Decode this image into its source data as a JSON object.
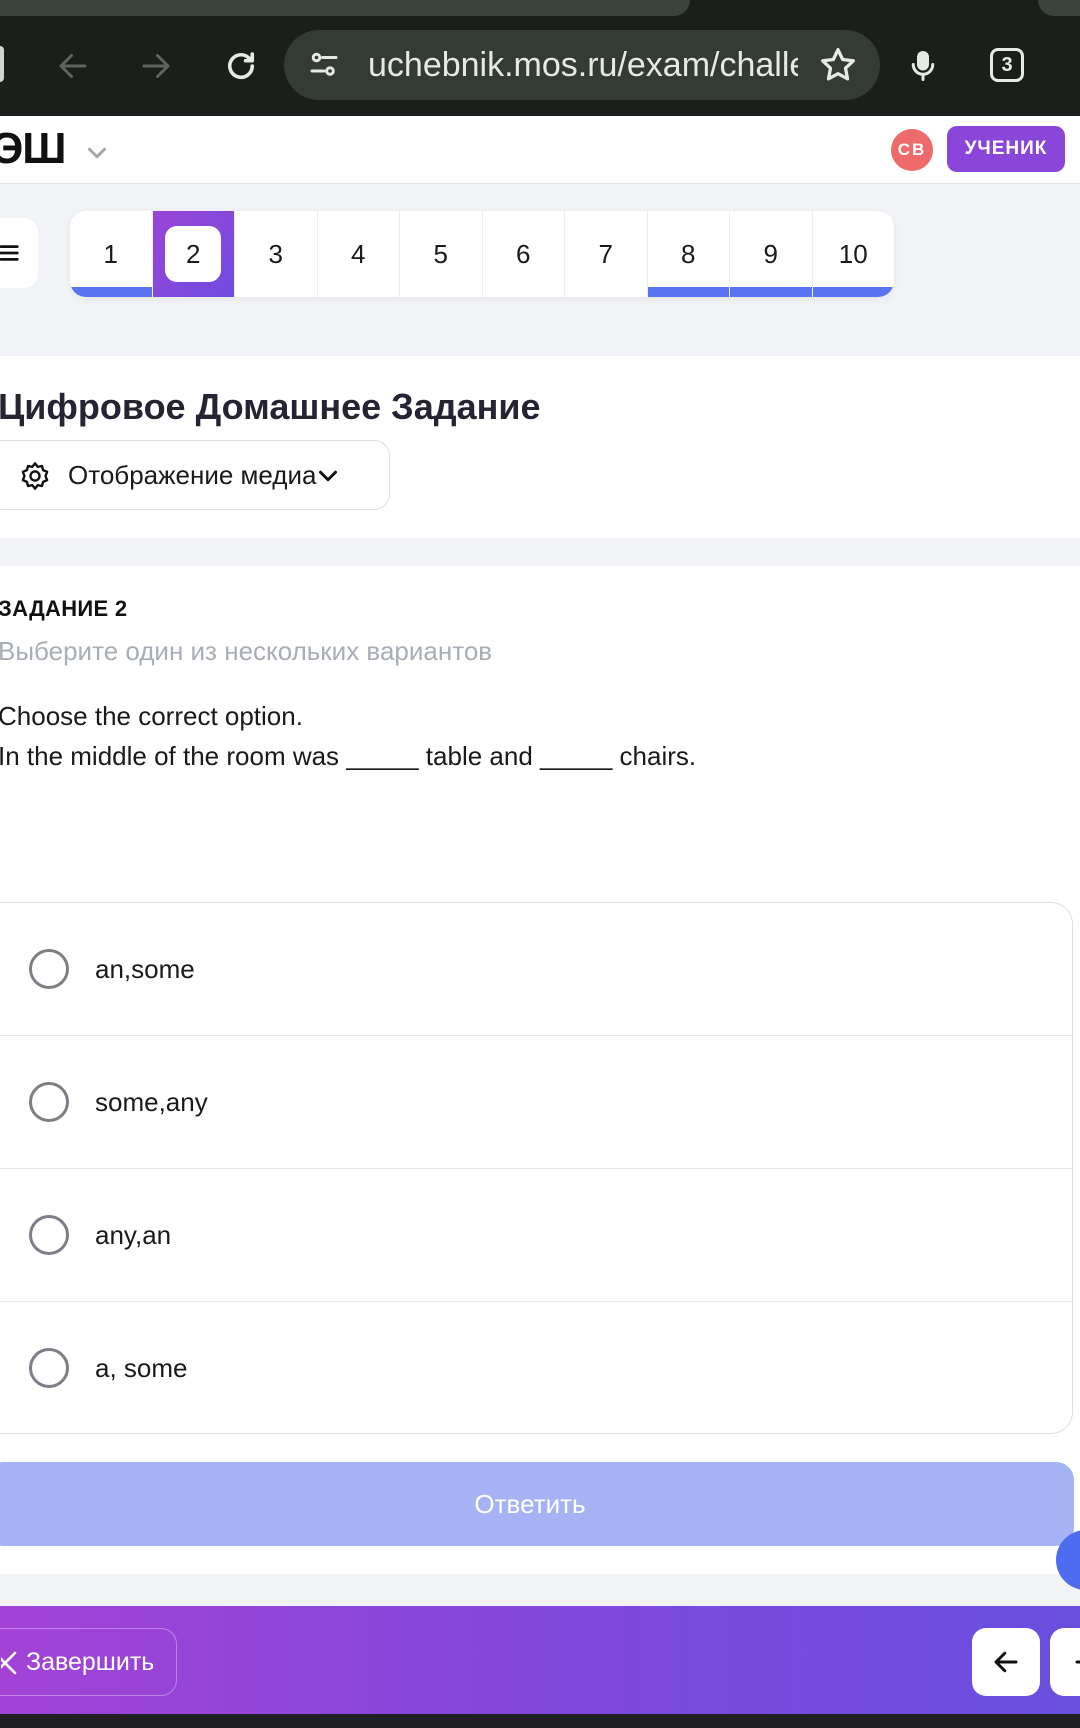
{
  "browser": {
    "url": "uchebnik.mos.ru/exam/challe",
    "tab_count": "3"
  },
  "header": {
    "logo": "ЭШ",
    "avatar_initials": "СВ",
    "role": "УЧЕНИК"
  },
  "question_nav": [
    {
      "label": "1",
      "status": "answered"
    },
    {
      "label": "2",
      "status": "current"
    },
    {
      "label": "3",
      "status": "none"
    },
    {
      "label": "4",
      "status": "none"
    },
    {
      "label": "5",
      "status": "none"
    },
    {
      "label": "6",
      "status": "none"
    },
    {
      "label": "7",
      "status": "none"
    },
    {
      "label": "8",
      "status": "answered"
    },
    {
      "label": "9",
      "status": "answered"
    },
    {
      "label": "10",
      "status": "answered"
    }
  ],
  "title_card": {
    "title": "Цифровое Домашнее Задание",
    "media_button": "Отображение медиа"
  },
  "task": {
    "label": "ЗАДАНИЕ 2",
    "hint": "Выберите один из нескольких вариантов",
    "instruction": "Choose the correct option.",
    "sentence": "In the middle of the room was _____ table and _____ chairs.",
    "options": [
      {
        "text": "an,some",
        "selected": false
      },
      {
        "text": "some,any",
        "selected": false
      },
      {
        "text": "any,an",
        "selected": false
      },
      {
        "text": "a, some",
        "selected": false
      }
    ],
    "submit": "Ответить"
  },
  "bottom_bar": {
    "finish": "Завершить"
  },
  "colors": {
    "accent_purple": "#8a45d9",
    "answered_blue": "#5a73f0",
    "submit_disabled": "#a5b3f5",
    "avatar_red": "#ef6a6a"
  },
  "icons": [
    "back-arrow-icon",
    "forward-arrow-icon",
    "reload-icon",
    "site-settings-icon",
    "star-icon",
    "microphone-icon",
    "tabs-icon",
    "chevron-down-icon",
    "hamburger-menu-icon",
    "gear-icon",
    "close-icon",
    "arrow-left-icon",
    "arrow-right-icon"
  ]
}
